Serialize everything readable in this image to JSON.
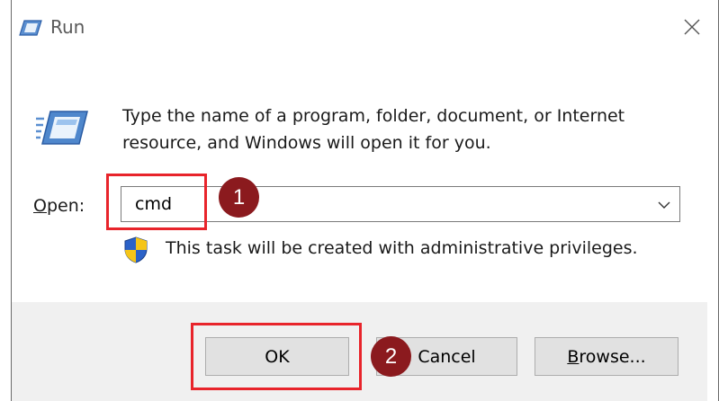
{
  "window": {
    "title": "Run",
    "title_icon": "run-icon",
    "close_icon": "close-icon"
  },
  "dialog": {
    "description": "Type the name of a program, folder, document, or Internet resource, and Windows will open it for you.",
    "program_icon": "run-program-icon",
    "open_label_first": "O",
    "open_label_rest": "pen:",
    "input_value": "cmd",
    "dropdown_icon": "chevron-down-icon",
    "shield_icon": "uac-shield-icon",
    "admin_note": "This task will be created with administrative privileges."
  },
  "buttons": {
    "ok": "OK",
    "cancel": "Cancel",
    "browse_first": "B",
    "browse_rest": "rowse..."
  },
  "annotations": {
    "step1": "1",
    "step2": "2",
    "highlight_color": "#e8242b",
    "badge_color": "#8b1a1e"
  }
}
